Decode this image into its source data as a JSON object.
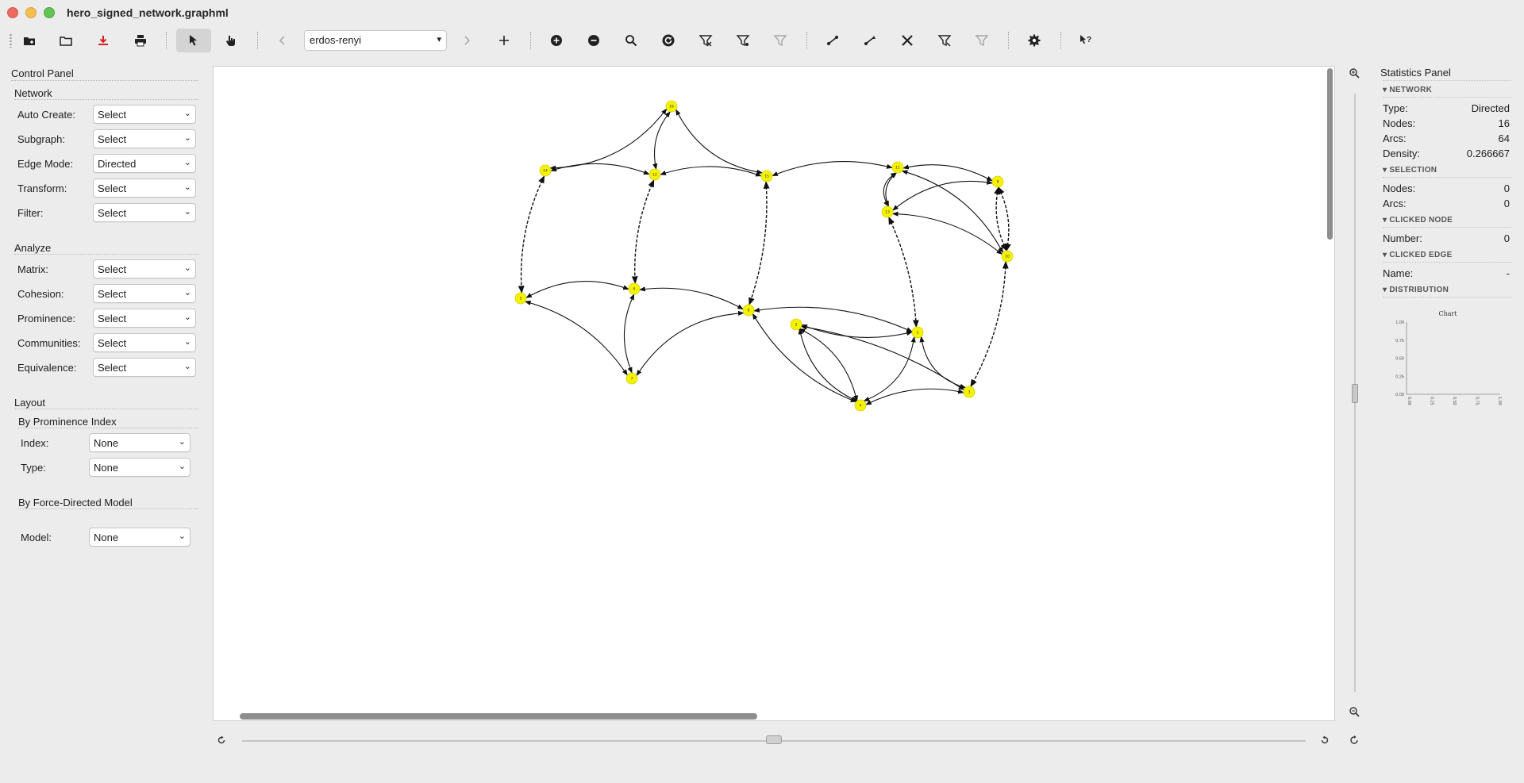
{
  "window": {
    "title": "hero_signed_network.graphml"
  },
  "toolbar": {
    "graph_type": "erdos-renyi",
    "icons": [
      "new-network-icon",
      "open-folder-icon",
      "save-icon",
      "print-icon",
      "select-pointer-icon",
      "hand-pointer-icon",
      "previous-icon",
      "next-icon",
      "add-icon",
      "zoom-in-icon",
      "zoom-out-icon",
      "zoom-search-icon",
      "rotate-icon",
      "filter-nodes-icon",
      "filter-edges-icon",
      "filter-clear-icon",
      "edge-add-icon",
      "edge-mode-icon",
      "tools-icon",
      "filter-weights-icon",
      "filter-unweighted-icon",
      "settings-icon",
      "whats-this-icon"
    ]
  },
  "control_panel": {
    "title": "Control Panel",
    "network": {
      "title": "Network",
      "rows": [
        {
          "label": "Auto Create:",
          "value": "Select"
        },
        {
          "label": "Subgraph:",
          "value": "Select"
        },
        {
          "label": "Edge Mode:",
          "value": "Directed"
        },
        {
          "label": "Transform:",
          "value": "Select"
        },
        {
          "label": "Filter:",
          "value": "Select"
        }
      ]
    },
    "analyze": {
      "title": "Analyze",
      "rows": [
        {
          "label": "Matrix:",
          "value": "Select"
        },
        {
          "label": "Cohesion:",
          "value": "Select"
        },
        {
          "label": "Prominence:",
          "value": "Select"
        },
        {
          "label": "Communities:",
          "value": "Select"
        },
        {
          "label": "Equivalence:",
          "value": "Select"
        }
      ]
    },
    "layout": {
      "title": "Layout",
      "by_prominence": {
        "title": "By Prominence Index",
        "rows": [
          {
            "label": "Index:",
            "value": "None"
          },
          {
            "label": "Type:",
            "value": "None"
          }
        ]
      },
      "by_force": {
        "title": "By Force-Directed Model",
        "rows": [
          {
            "label": "Model:",
            "value": "None"
          }
        ]
      }
    }
  },
  "graph": {
    "node_color": "#f5f200",
    "node_labels": [
      "16",
      "14",
      "12",
      "15",
      "11",
      "13",
      "9",
      "10",
      "1",
      "2",
      "3",
      "4",
      "5",
      "6",
      "7",
      "8"
    ]
  },
  "statistics": {
    "title": "Statistics Panel",
    "network": {
      "title": "NETWORK",
      "type_label": "Type:",
      "type_value": "Directed",
      "nodes_label": "Nodes:",
      "nodes_value": "16",
      "arcs_label": "Arcs:",
      "arcs_value": "64",
      "density_label": "Density:",
      "density_value": "0.266667"
    },
    "selection": {
      "title": "SELECTION",
      "nodes_label": "Nodes:",
      "nodes_value": "0",
      "arcs_label": "Arcs:",
      "arcs_value": "0"
    },
    "clicked_node": {
      "title": "CLICKED NODE",
      "number_label": "Number:",
      "number_value": "0"
    },
    "clicked_edge": {
      "title": "CLICKED EDGE",
      "name_label": "Name:",
      "name_value": "-"
    },
    "distribution": {
      "title": "DISTRIBUTION",
      "chart_title": "Chart",
      "y_ticks": [
        "1.00",
        "0.75",
        "0.50",
        "0.25",
        "0.00"
      ],
      "x_ticks": [
        "0.00",
        "0.25",
        "0.50",
        "0.75",
        "1.00"
      ]
    }
  }
}
